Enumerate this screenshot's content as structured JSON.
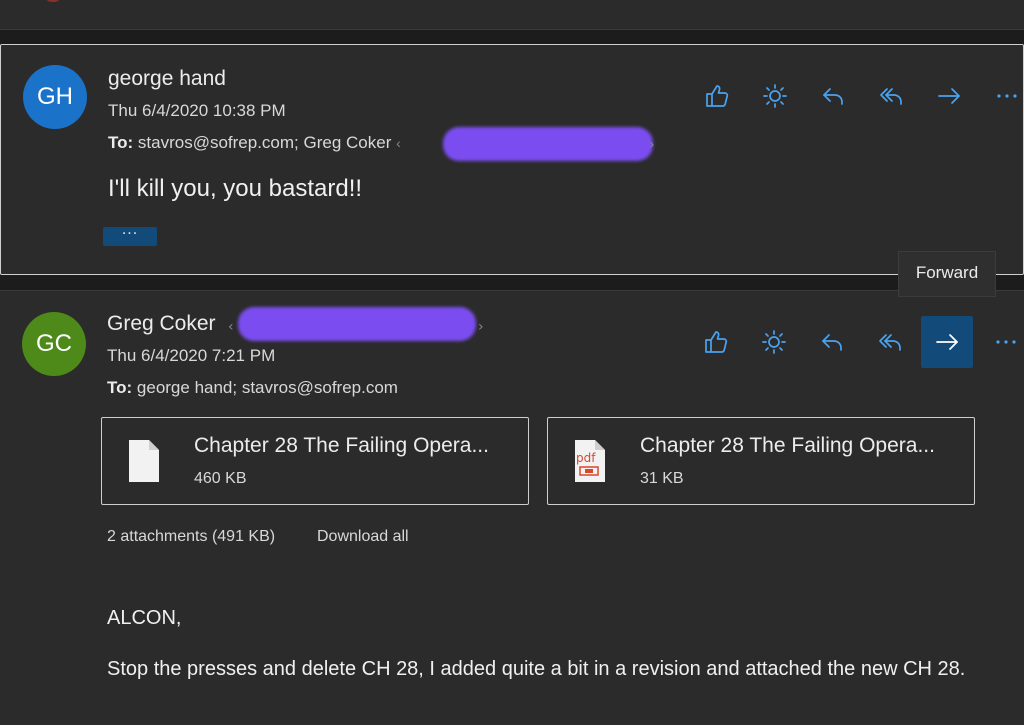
{
  "messages": [
    {
      "initials": "GH",
      "sender": "george hand",
      "date": "Thu 6/4/2020 10:38 PM",
      "to_label": "To:",
      "to": "stavros@sofrep.com; Greg Coker",
      "body": "I'll kill you, you bastard!!",
      "more_label": "···",
      "avatar_color": "#1a73c9"
    },
    {
      "initials": "GC",
      "sender": "Greg Coker",
      "date": "Thu 6/4/2020 7:21 PM",
      "to_label": "To:",
      "to": "george hand; stavros@sofrep.com",
      "avatar_color": "#4e8a1a",
      "attachments": [
        {
          "name": "Chapter 28 The Failing Opera...",
          "size": "460 KB",
          "icon": "document-icon"
        },
        {
          "name": "Chapter 28 The Failing Opera...",
          "size": "31 KB",
          "icon": "pdf-icon"
        }
      ],
      "attachments_summary": "2 attachments (491 KB)",
      "download_all": "Download all",
      "body_greeting": "ALCON,",
      "body_text": "Stop the presses and delete CH 28, I added quite a bit in a revision and attached the new CH 28."
    }
  ],
  "actions": [
    "like",
    "sun",
    "reply",
    "reply-all",
    "forward",
    "more"
  ],
  "tooltip": "Forward",
  "accent_color": "#4aa3f0",
  "active_button_color": "#124a7a",
  "redaction_color": "#7b4df0"
}
